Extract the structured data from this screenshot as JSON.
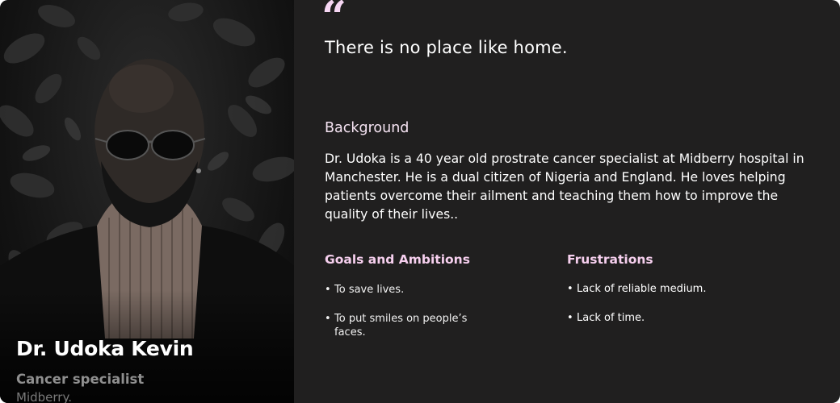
{
  "profile": {
    "name": "Dr. Udoka Kevin",
    "role": "Cancer specialist",
    "organization": "Midberry."
  },
  "quote": {
    "mark": "“",
    "text": "There is no place like home."
  },
  "background": {
    "heading": "Background",
    "body": "Dr. Udoka is a 40 year old prostrate cancer specialist at Midberry hospital in Manchester. He is a dual citizen of Nigeria and England. He loves helping patients overcome their ailment and teaching them how to improve the quality of their lives.."
  },
  "goals": {
    "heading": "Goals and Ambitions",
    "items": [
      "To save lives.",
      "To put smiles on people’s faces."
    ]
  },
  "frustrations": {
    "heading": "Frustrations",
    "items": [
      "Lack of reliable medium.",
      "Lack of time."
    ]
  },
  "colors": {
    "card_background": "#201f1f",
    "accent_pink": "#f6cfee",
    "text_white": "#ffffff"
  }
}
